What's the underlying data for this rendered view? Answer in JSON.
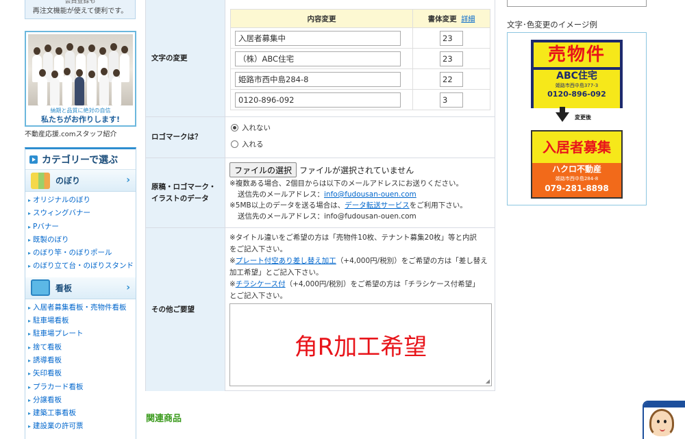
{
  "sidebar": {
    "top_note_partial": "会員登録も",
    "top_note": "再注文機能が使えて便利です。",
    "staff_caption_small": "納期と品質に絶対の自信",
    "staff_caption_big": "私たちがお作りします!",
    "staff_link": "不動産応援.comスタッフ紹介",
    "category_title": "カテゴリーで選ぶ",
    "groups": [
      {
        "title": "のぼり",
        "icon": "flag-icon",
        "items": [
          "オリジナルのぼり",
          "スウィングバナー",
          "Pバナー",
          "既製のぼり",
          "のぼり竿・のぼりポール",
          "のぼり立て台・のぼりスタンド"
        ]
      },
      {
        "title": "看板",
        "icon": "signboard-icon",
        "items": [
          "入居者募集看板・売物件看板",
          "駐車場看板",
          "駐車場プレート",
          "捨て看板",
          "誘導看板",
          "矢印看板",
          "プラカード看板",
          "分譲看板",
          "建築工事看板",
          "建設業の許可票"
        ]
      }
    ]
  },
  "form": {
    "text_change": {
      "label": "文字の変更",
      "col_content": "内容変更",
      "col_font": "書体変更",
      "detail_link": "詳細",
      "rows": [
        {
          "text": "入居者募集中",
          "font": "23"
        },
        {
          "text": "（株）ABC住宅",
          "font": "23"
        },
        {
          "text": "姫路市西中島284-8",
          "font": "22"
        },
        {
          "text": "0120-896-092",
          "font": "3"
        }
      ]
    },
    "logo": {
      "label": "ロゴマークは？",
      "options": [
        {
          "label": "入れない",
          "selected": true
        },
        {
          "label": "入れる",
          "selected": false
        }
      ]
    },
    "manuscript": {
      "label_line1": "原稿・ロゴマーク・",
      "label_line2": "イラストのデータ",
      "file_button": "ファイルの選択",
      "file_status": "ファイルが選択されていません",
      "note1": "※複数ある場合、2個目からは以下のメールアドレスにお送りください。",
      "note1b_prefix": "送信先のメールアドレス：",
      "email_link": "info@fudousan-ouen.com",
      "note2_prefix": "※5MB以上のデータを送る場合は、",
      "note2_link": "データ転送サービス",
      "note2_suffix": "をご利用下さい。",
      "note2b": "送信先のメールアドレス：info@fudousan-ouen.com"
    },
    "other": {
      "label": "その他ご要望",
      "line1": "※タイトル違いをご希望の方は「売物件10枚、テナント募集20枚」等と内訳",
      "line2": "をご記入下さい。",
      "line3_prefix": "※",
      "line3_link": "プレート付空あり差し替え加工",
      "line3_suffix": "（+4,000円/税別）をご希望の方は「差し替え",
      "line4": "加工希望」とご記入下さい。",
      "line5_prefix": "※",
      "line5_link": "チラシケース付",
      "line5_suffix": "（+4,000円/税別）をご希望の方は「チラシケース付希望」",
      "line6": "とご記入下さい。",
      "textarea_value": "角R加工希望"
    }
  },
  "related": {
    "title": "関連商品"
  },
  "right": {
    "title": "文字･色変更のイメージ例",
    "before": {
      "head": "売物件",
      "company": "ABC住宅",
      "address": "姫路市西中島377-3",
      "phone": "0120-896-092"
    },
    "after_label": "変更後",
    "after": {
      "head": "入居者募集",
      "company": "ハクロ不動産",
      "address": "姫路市西中島284-8",
      "phone": "079-281-8898"
    }
  },
  "colors": {
    "accent_blue": "#2d8ed0",
    "label_bg": "#e6f1f9",
    "table_head": "#fdf8d2",
    "related_green": "#3a9a1c",
    "memo_red": "#e8141a"
  }
}
